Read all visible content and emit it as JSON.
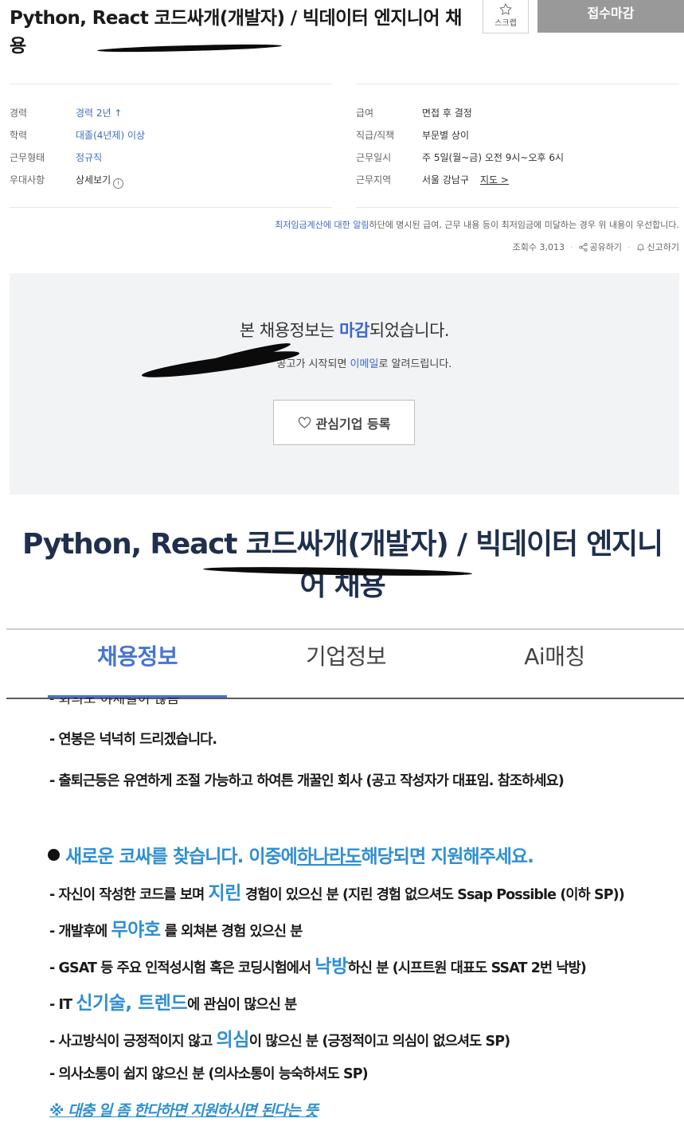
{
  "header": {
    "title": "Python, React 코드싸개(개발자) / 빅데이터 엔지니어 채용",
    "scrap_label": "스크랩",
    "closed_button": "접수마감"
  },
  "info": {
    "left": [
      {
        "key": "경력",
        "value": "경력 2년 ↑"
      },
      {
        "key": "학력",
        "value": "대졸(4년제) 이상"
      },
      {
        "key": "근무형태",
        "value": "정규직"
      },
      {
        "key": "우대사항",
        "value": "상세보기"
      }
    ],
    "right": [
      {
        "key": "급여",
        "value": "면접 후 결정"
      },
      {
        "key": "직급/직책",
        "value": "부문별 상이"
      },
      {
        "key": "근무일시",
        "value": "주 5일(월~금) 오전 9시~오후 6시"
      },
      {
        "key": "근무지역",
        "value": "서울 강남구",
        "extra": "지도 >"
      }
    ]
  },
  "notice": {
    "link": "최저임금계산에 대한 알림",
    "text": "하단에 명시된 급여, 근무 내용 등이 최저임금에 미달하는 경우 위 내용이 우선합니다."
  },
  "meta": {
    "views": "조회수 3,013",
    "share": "공유하기",
    "report": "신고하기"
  },
  "closed_box": {
    "main_pre": "본 채용정보는 ",
    "main_hl": "마감",
    "main_post": "되었습니다.",
    "sub_pre": "공고가 시작되면 ",
    "sub_hl": "이메일",
    "sub_post": "로 알려드립니다.",
    "fav_button": "관심기업 등록"
  },
  "big_title": "Python, React 코드싸개(개발자) / 빅데이터 엔지니어 채용",
  "tabs": [
    {
      "label": "채용정보",
      "active": true
    },
    {
      "label": "기업정보",
      "active": false
    },
    {
      "label": "Ai매칭",
      "active": false
    }
  ],
  "cut_text": "- 회의도 야제될이 많음",
  "lines_top": [
    "- 연봉은 넉넉히 드리겠습니다.",
    "- 출퇴근등은 유연하게 조절 가능하고 하여튼 개꿀인 회사 (공고 작성자가 대표임. 참조하세요)"
  ],
  "heading": {
    "pre": "새로운 코싸를 찾습니다. 이중에 ",
    "underlined": "하나라도",
    "post": " 해당되면 지원해주세요."
  },
  "requirements": [
    {
      "pre": "- 자신이 작성한 코드를 보며 ",
      "em": "지린",
      "post": " 경험이 있으신 분 (지린 경험 없으셔도 Ssap Possible (이하 SP))"
    },
    {
      "pre": "- 개발후에 ",
      "em": "무야호",
      "post": " 를 외쳐본 경험 있으신 분"
    },
    {
      "pre": "- GSAT 등 주요 인적성시험 혹은 코딩시험에서 ",
      "em": "낙방",
      "post": "하신 분 (시프트원 대표도 SSAT 2번 낙방)"
    },
    {
      "pre": "- IT ",
      "em": "신기술, 트렌드",
      "post": "에 관심이 많으신 분"
    },
    {
      "pre": "- 사고방식이 긍정적이지 않고 ",
      "em": "의심",
      "post": "이 많으신 분 (긍정적이고 의심이 없으셔도 SP)"
    },
    {
      "pre": "- 의사소통이 쉽지 않으신 분 (의사소통이 능숙하셔도 SP)",
      "em": "",
      "post": ""
    }
  ],
  "footnote": "※ 대충 일 좀 한다하면 지원하시면 된다는 뜻",
  "colors": {
    "accent": "#3c67c9",
    "tab_active": "#4775d1",
    "emphasis": "#2f8fd0",
    "closed_button_bg": "#999999",
    "closed_box_bg": "#f2f3f5"
  }
}
